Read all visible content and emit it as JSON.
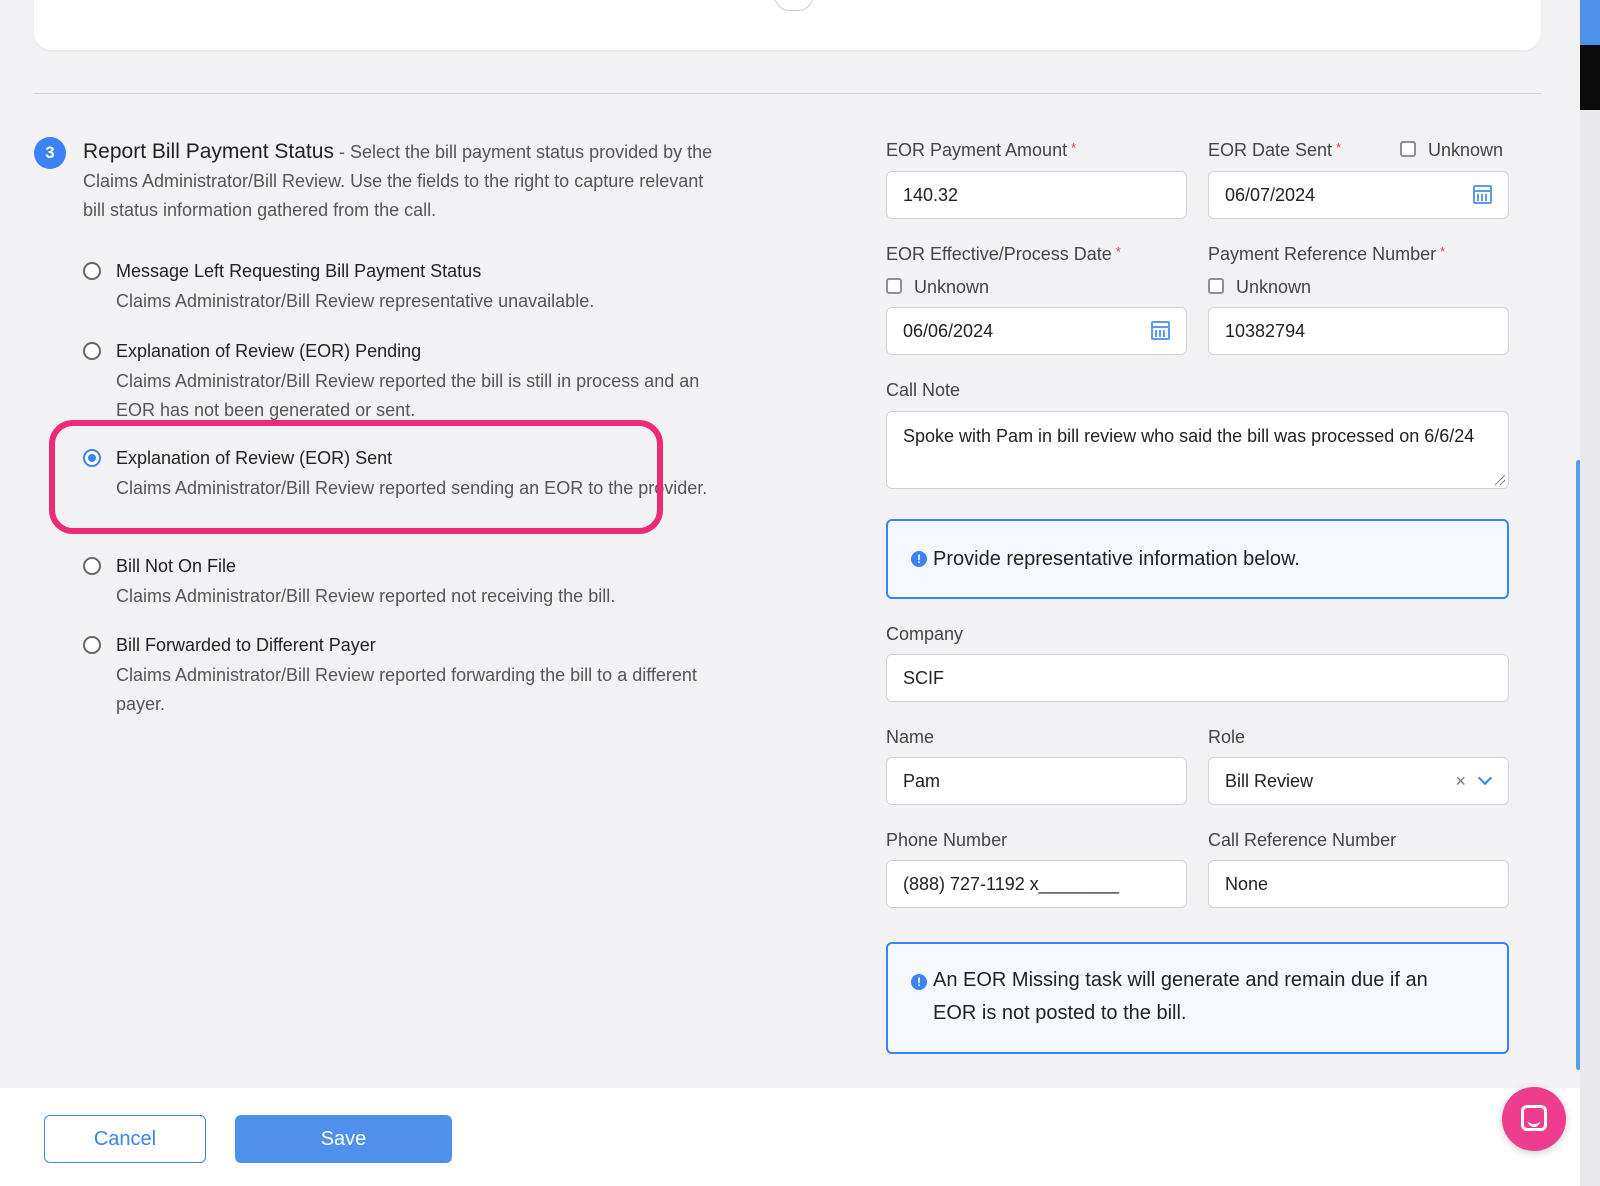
{
  "section": {
    "step": "3",
    "title": "Report Bill Payment Status",
    "description": " - Select the bill payment status provided by the Claims Administrator/Bill Review. Use the fields to the right to capture relevant bill status information gathered from the call."
  },
  "options": [
    {
      "title": "Message Left Requesting Bill Payment Status",
      "description": "Claims Administrator/Bill Review representative unavailable.",
      "selected": false
    },
    {
      "title": "Explanation of Review (EOR) Pending",
      "description": "Claims Administrator/Bill Review reported the bill is still in process and an EOR has not been generated or sent.",
      "selected": false
    },
    {
      "title": "Explanation of Review (EOR) Sent",
      "description": "Claims Administrator/Bill Review reported sending an EOR to the provider.",
      "selected": true
    },
    {
      "title": "Bill Not On File",
      "description": "Claims Administrator/Bill Review reported not receiving the bill.",
      "selected": false
    },
    {
      "title": "Bill Forwarded to Different Payer",
      "description": "Claims Administrator/Bill Review reported forwarding the bill to a different payer.",
      "selected": false
    }
  ],
  "form": {
    "eor_payment_amount": {
      "label": "EOR Payment Amount",
      "required": "*",
      "value": "140.32"
    },
    "eor_date_sent": {
      "label": "EOR Date Sent",
      "required": "*",
      "unknown_label": "Unknown",
      "unknown_checked": false,
      "value": "06/07/2024"
    },
    "eor_effective_date": {
      "label": "EOR Effective/Process Date",
      "required": "*",
      "unknown_label": "Unknown",
      "unknown_checked": false,
      "value": "06/06/2024"
    },
    "payment_reference_number": {
      "label": "Payment Reference Number",
      "required": "*",
      "unknown_label": "Unknown",
      "unknown_checked": false,
      "value": "10382794"
    },
    "call_note": {
      "label": "Call Note",
      "value": "Spoke with Pam in bill review who said the bill was processed on 6/6/24"
    },
    "info_representative": "Provide representative information below.",
    "company": {
      "label": "Company",
      "value": "SCIF"
    },
    "name": {
      "label": "Name",
      "value": "Pam"
    },
    "role": {
      "label": "Role",
      "value": "Bill Review",
      "clear": "×"
    },
    "phone_number": {
      "label": "Phone Number",
      "value": "(888) 727-1192 x________"
    },
    "call_reference_number": {
      "label": "Call Reference Number",
      "value": "None"
    },
    "info_eor_missing": "An EOR Missing task will generate and remain due if an EOR is not posted to the bill."
  },
  "footer": {
    "cancel_label": "Cancel",
    "save_label": "Save"
  },
  "icons": {
    "calendar": "calendar-icon",
    "info": "info-icon",
    "chat": "chat-icon",
    "chevron": "chevron-down-icon"
  },
  "colors": {
    "accent": "#3b82f6",
    "highlight": "#ec2a78",
    "required": "#e53935",
    "chat": "#ee3d8f"
  }
}
